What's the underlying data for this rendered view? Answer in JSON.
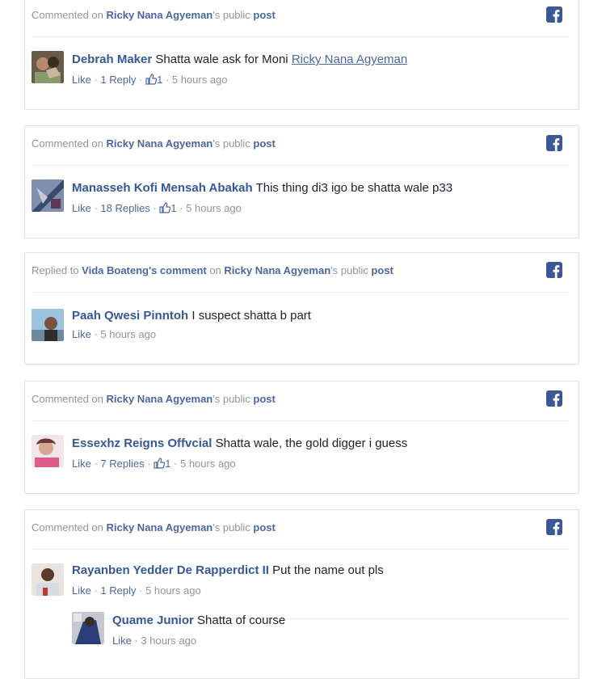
{
  "cards": [
    {
      "context": {
        "prefix": "Commented on ",
        "person": "Ricky Nana Agyeman",
        "suffix": "'s public ",
        "post": "post"
      },
      "comment": {
        "author": "Debrah Maker",
        "text": " Shatta wale ask for Moni ",
        "mention": "Ricky Nana Agyeman",
        "like": "Like",
        "sep1": " · ",
        "replies": "1 Reply",
        "sep2": " · ",
        "likes_count": "1",
        "sep3": " · ",
        "time": "5 hours ago"
      }
    },
    {
      "context": {
        "prefix": "Commented on ",
        "person": "Ricky Nana Agyeman",
        "suffix": "'s public ",
        "post": "post"
      },
      "comment": {
        "author": "Manasseh Kofi Mensah Abakah",
        "text": " This thing di3 igo be shatta wale p33",
        "like": "Like",
        "sep1": " · ",
        "replies": "18 Replies",
        "sep2": " · ",
        "likes_count": "1",
        "sep3": " · ",
        "time": "5 hours ago"
      }
    },
    {
      "context": {
        "prefix": "Replied to ",
        "target": "Vida Boateng's comment",
        "mid": " on ",
        "person": "Ricky Nana Agyeman",
        "suffix": "'s public ",
        "post": "post"
      },
      "comment": {
        "author": "Paah Qwesi Pinntoh",
        "text": " I suspect shatta b part",
        "like": "Like",
        "sep1": " · ",
        "time": "5 hours ago"
      }
    },
    {
      "context": {
        "prefix": "Commented on ",
        "person": "Ricky Nana Agyeman",
        "suffix": "'s public ",
        "post": "post"
      },
      "comment": {
        "author": "Essexhz Reigns Offvcial",
        "text": " Shatta wale, the gold digger i guess",
        "like": "Like",
        "sep1": " · ",
        "replies": "7 Replies",
        "sep2": " · ",
        "likes_count": "1",
        "sep3": " · ",
        "time": "5 hours ago"
      }
    },
    {
      "context": {
        "prefix": "Commented on ",
        "person": "Ricky Nana Agyeman",
        "suffix": "'s public ",
        "post": "post"
      },
      "comment": {
        "author": "Rayanben Yedder De Rapperdict II",
        "text": " Put the name out pls",
        "like": "Like",
        "sep1": " · ",
        "replies": "1 Reply",
        "sep2": " · ",
        "time": "5 hours ago"
      },
      "reply": {
        "author": "Quame Junior",
        "text": " Shatta of course",
        "like": "Like",
        "sep1": " · ",
        "time": "3 hours ago"
      }
    }
  ],
  "colors": {
    "facebook_blue": "#3b5998",
    "link": "#365899",
    "meta": "#90949c"
  }
}
